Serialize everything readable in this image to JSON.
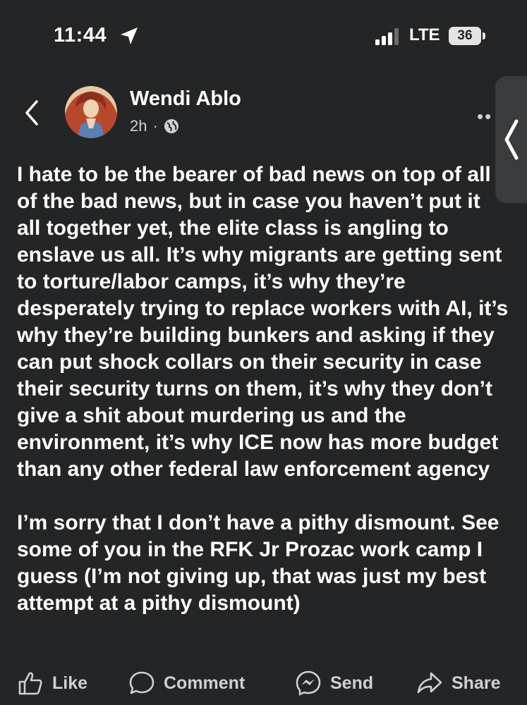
{
  "status_bar": {
    "time": "11:44",
    "network": "LTE",
    "battery": "36"
  },
  "post": {
    "author": "Wendi Ablo",
    "age": "2h",
    "paragraphs": [
      "I hate to be the bearer of bad news on top of all of the bad news, but in case you haven’t put it all together yet, the elite class is angling to enslave us all. It’s why migrants are getting sent to torture/labor camps, it’s why they’re desperately trying to replace workers with AI, it’s why they’re building bunkers and asking if they can put shock collars on their security in case their security turns on them, it’s why they don’t give a shit about murdering us and the environment, it’s why ICE now has more budget than any other federal law enforcement agency",
      "I’m sorry that I don’t have a pithy dismount. See some of you in the RFK Jr Prozac work camp I guess (I’m not giving up, that was just my best attempt at a pithy dismount)"
    ]
  },
  "actions": {
    "like": "Like",
    "comment": "Comment",
    "send": "Send",
    "share": "Share"
  },
  "icons": [
    "location-arrow-icon",
    "signal-icon",
    "back-chevron-icon",
    "globe-icon",
    "more-icon",
    "side-chevron-icon",
    "thumbs-up-icon",
    "comment-bubble-icon",
    "messenger-icon",
    "share-arrow-icon"
  ],
  "colors": {
    "background": "#242526",
    "text": "#ffffff",
    "secondary_text": "#cfd0d2",
    "side_tab": "#3a3b3c"
  }
}
